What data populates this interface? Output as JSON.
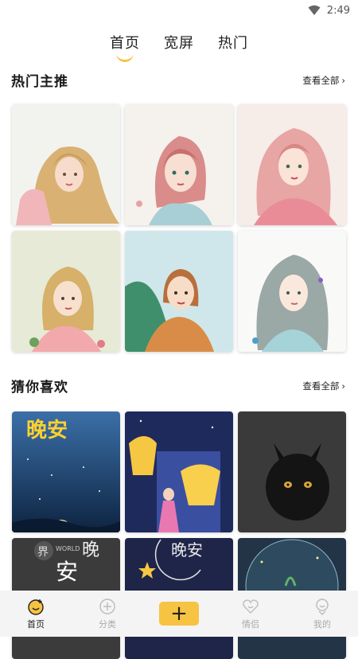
{
  "status": {
    "time": "2:49"
  },
  "tabs": [
    {
      "label": "首页"
    },
    {
      "label": "宽屏"
    },
    {
      "label": "热门"
    }
  ],
  "hot": {
    "title": "热门主推",
    "see_all": "查看全部",
    "items": [
      {
        "icon": "girl-blonde-portrait"
      },
      {
        "icon": "girl-pink-hair-portrait"
      },
      {
        "icon": "girl-pink-curls-portrait"
      },
      {
        "icon": "girl-blonde-flowers-portrait"
      },
      {
        "icon": "girl-orange-jacket-portrait"
      },
      {
        "icon": "girl-silver-hair-portrait"
      }
    ]
  },
  "guess": {
    "title": "猜你喜欢",
    "see_all": "查看全部",
    "items": [
      {
        "text": "晚安"
      },
      {
        "icon": "lanterns-girl-illustration"
      },
      {
        "icon": "black-cat-photo"
      },
      {
        "text": "界",
        "text2": "WORLD",
        "text3": "晚",
        "text4": "安"
      },
      {
        "text": "晚安"
      },
      {
        "icon": "glass-globe-plant-photo"
      }
    ]
  },
  "nav": [
    {
      "label": "首页",
      "icon": "home-face-icon"
    },
    {
      "label": "分类",
      "icon": "category-icon"
    },
    {
      "label": "+",
      "icon": "plus-icon"
    },
    {
      "label": "情侣",
      "icon": "couple-heart-icon"
    },
    {
      "label": "我的",
      "icon": "profile-icon"
    }
  ]
}
